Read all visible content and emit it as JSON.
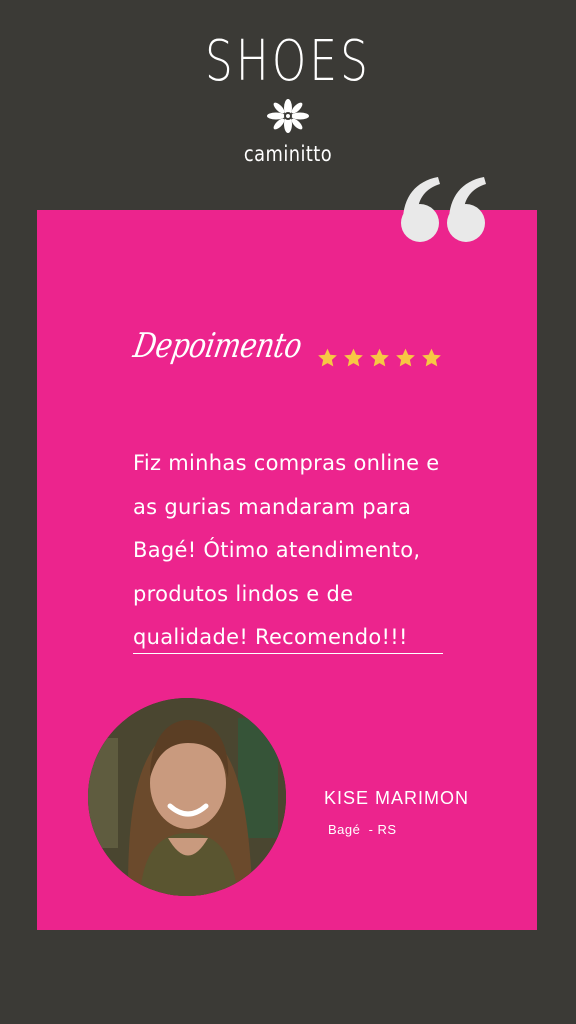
{
  "colors": {
    "background": "#3b3a36",
    "card": "#ec248d",
    "stars": "#f7c744",
    "quote": "#e9e9e9"
  },
  "brand": {
    "title": "SHOES",
    "subtitle": "caminitto",
    "icon": "flower-icon"
  },
  "testimonial": {
    "heading": "Depoimento",
    "rating": 5,
    "rating_icon": "star-icon",
    "quote_icon": "quote-mark-icon",
    "text": "Fiz minhas compras online e as gurias mandaram para Bagé! Ótimo atendimento, produtos lindos e de qualidade! Recomendo!!!"
  },
  "author": {
    "name": "KISE MARIMON",
    "location": "Bagé  - RS"
  }
}
